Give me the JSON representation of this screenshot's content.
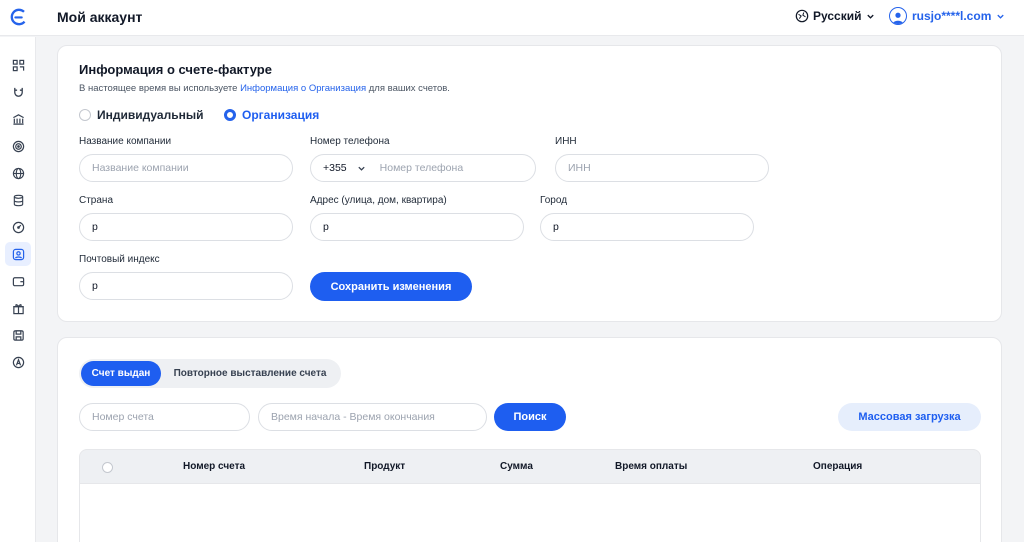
{
  "header": {
    "title": "Мой аккаунт",
    "language": "Русский",
    "user_email": "rusjo****l.com"
  },
  "sidebar": {
    "items": [
      {
        "icon": "grid-icon"
      },
      {
        "icon": "magnet-icon"
      },
      {
        "icon": "bank-icon"
      },
      {
        "icon": "target-icon"
      },
      {
        "icon": "globe-icon"
      },
      {
        "icon": "database-icon"
      },
      {
        "icon": "speedometer-icon"
      },
      {
        "icon": "profile-icon",
        "active": true
      },
      {
        "icon": "wallet-icon"
      },
      {
        "icon": "gift-icon"
      },
      {
        "icon": "save-icon"
      },
      {
        "icon": "badge-icon"
      }
    ]
  },
  "invoice_info": {
    "title": "Информация о счете-фактуре",
    "sub_prefix": "В настоящее время вы используете ",
    "sub_link": "Информация о Организация",
    "sub_suffix": " для ваших счетов.",
    "radio_individual": "Индивидуальный",
    "radio_organization": "Организация",
    "selected": "organization",
    "fields": {
      "company_label": "Название компании",
      "company_placeholder": "Название компании",
      "phone_label": "Номер телефона",
      "phone_code": "+355",
      "phone_placeholder": "Номер телефона",
      "inn_label": "ИНН",
      "inn_placeholder": "ИНН",
      "country_label": "Страна",
      "country_value": "р",
      "address_label": "Адрес (улица, дом, квартира)",
      "address_value": "р",
      "city_label": "Город",
      "city_value": "р",
      "postal_label": "Почтовый индекс",
      "postal_value": "р"
    },
    "save_button": "Сохранить изменения"
  },
  "invoices": {
    "tabs": [
      "Счет выдан",
      "Повторное выставление счета"
    ],
    "active_tab": 0,
    "search_number_placeholder": "Номер счета",
    "date_range_placeholder": "Время начала - Время окончания",
    "search_button": "Поиск",
    "bulk_button": "Массовая загрузка",
    "columns": [
      "Номер счета",
      "Продукт",
      "Сумма",
      "Время оплаты",
      "Операция"
    ]
  },
  "colors": {
    "accent": "#1e5ef0",
    "link": "#2563eb",
    "active_sidebar_bg": "#e8efff"
  }
}
